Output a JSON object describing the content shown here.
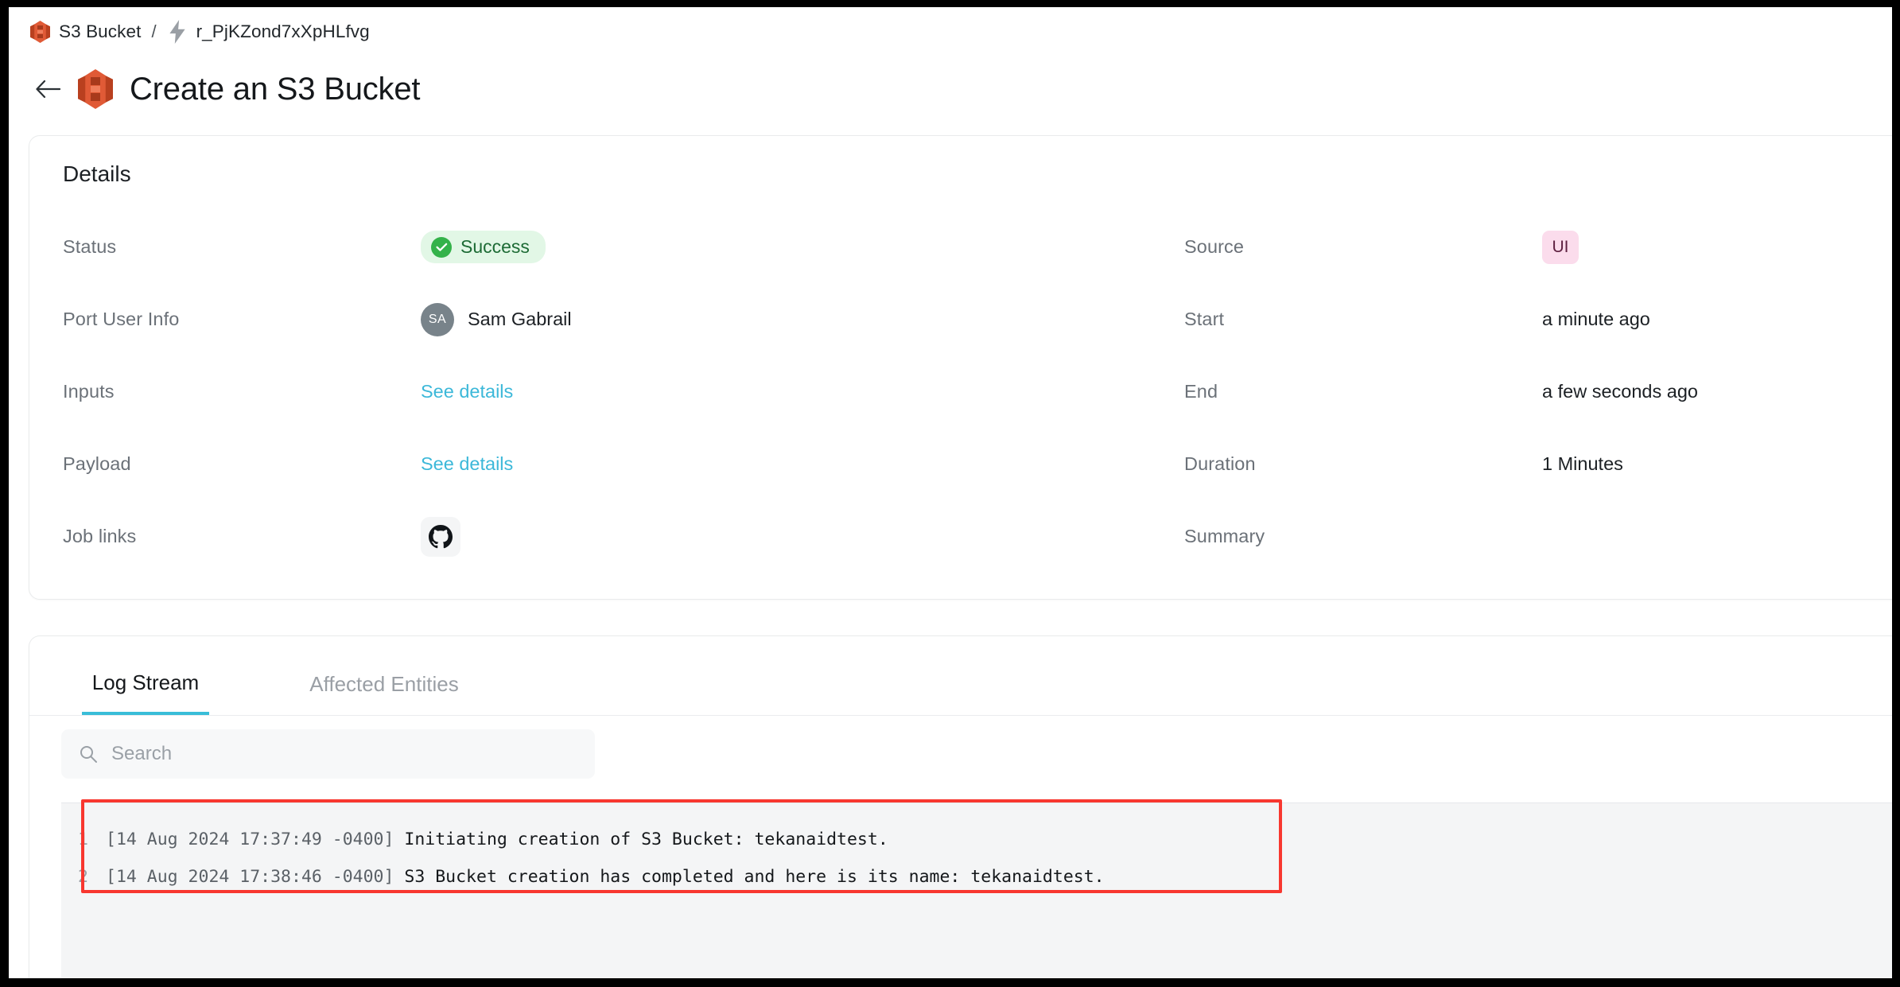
{
  "breadcrumb": {
    "items": [
      {
        "label": "S3 Bucket",
        "icon": "s3-bucket-icon"
      },
      {
        "label": "r_PjKZond7xXpHLfvg",
        "icon": "lightning-bolt-icon"
      }
    ],
    "separator": "/"
  },
  "header": {
    "title": "Create an S3 Bucket",
    "back_icon": "back-arrow-icon",
    "title_icon": "s3-bucket-icon"
  },
  "details": {
    "section_title": "Details",
    "left_rows": [
      {
        "label": "Status",
        "value": "Success",
        "type": "status-badge"
      },
      {
        "label": "Port User Info",
        "value": "Sam Gabrail",
        "type": "user",
        "initials": "SA"
      },
      {
        "label": "Inputs",
        "value": "See details",
        "type": "link"
      },
      {
        "label": "Payload",
        "value": "See details",
        "type": "link"
      },
      {
        "label": "Job links",
        "value": "",
        "type": "icon",
        "icon": "github-icon"
      }
    ],
    "right_rows": [
      {
        "label": "Source",
        "value": "UI",
        "type": "source-badge"
      },
      {
        "label": "Start",
        "value": "a minute ago",
        "type": "text"
      },
      {
        "label": "End",
        "value": "a few seconds ago",
        "type": "text"
      },
      {
        "label": "Duration",
        "value": "1 Minutes",
        "type": "text"
      },
      {
        "label": "Summary",
        "value": "",
        "type": "text"
      }
    ]
  },
  "logs": {
    "tabs": [
      {
        "label": "Log Stream",
        "active": true
      },
      {
        "label": "Affected Entities",
        "active": false
      }
    ],
    "search": {
      "placeholder": "Search",
      "value": "",
      "icon": "search-icon"
    },
    "lines": [
      {
        "number": "1",
        "timestamp": "[14 Aug 2024 17:37:49 -0400]",
        "message": "Initiating creation of S3 Bucket: tekanaidtest."
      },
      {
        "number": "2",
        "timestamp": "[14 Aug 2024 17:38:46 -0400]",
        "message": "S3 Bucket creation has completed and here is its name: tekanaidtest."
      }
    ]
  },
  "colors": {
    "accent_cyan": "#39bdd8",
    "link_cyan": "#3cb8d9",
    "success_bg": "#e2f7e6",
    "success_fg": "#1d6b35",
    "success_dot": "#34b24a",
    "source_bg": "#fbdcec",
    "source_fg": "#5e2040",
    "avatar_bg": "#78838a",
    "annotation_red": "#f8372f",
    "s3_orange": "#e05a36"
  }
}
